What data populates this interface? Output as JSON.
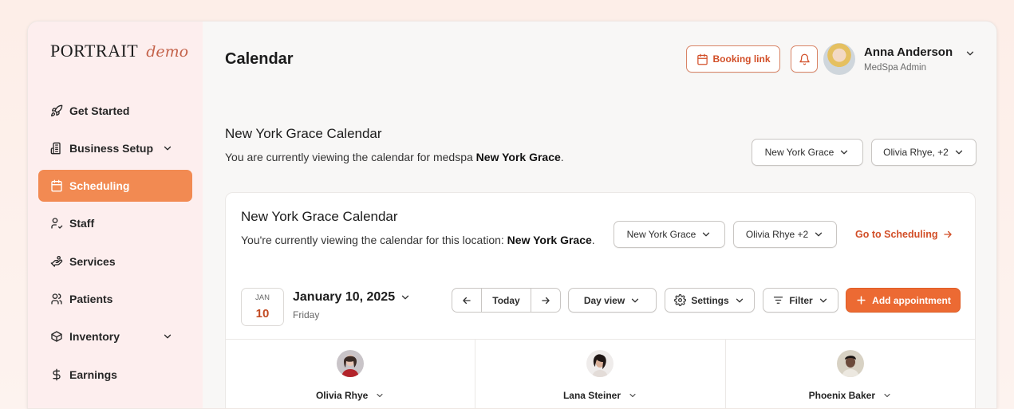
{
  "brand": {
    "name": "PORTRAIT",
    "tag": "demo"
  },
  "sidebar": {
    "items": [
      {
        "label": "Get Started",
        "icon": "rocket-icon"
      },
      {
        "label": "Business Setup",
        "icon": "building-icon",
        "expandable": true
      },
      {
        "label": "Scheduling",
        "icon": "calendar-icon",
        "active": true
      },
      {
        "label": "Staff",
        "icon": "staff-icon"
      },
      {
        "label": "Services",
        "icon": "hand-service-icon"
      },
      {
        "label": "Patients",
        "icon": "users-icon"
      },
      {
        "label": "Inventory",
        "icon": "box-icon",
        "expandable": true
      },
      {
        "label": "Earnings",
        "icon": "dollar-icon"
      }
    ]
  },
  "header": {
    "title": "Calendar",
    "booking_link_label": "Booking link",
    "user": {
      "name": "Anna Anderson",
      "role": "MedSpa Admin"
    }
  },
  "section": {
    "title": "New York Grace Calendar",
    "desc_prefix": "You are currently viewing the calendar for medspa ",
    "desc_bold": "New York Grace",
    "desc_suffix": ".",
    "location_select": "New York Grace",
    "staff_select": "Olivia Rhye, +2"
  },
  "card": {
    "title": "New York Grace Calendar",
    "desc_prefix": "You're currently viewing the calendar for this location: ",
    "desc_bold": "New York Grace",
    "desc_suffix": ".",
    "location_select": "New York Grace",
    "staff_select": "Olivia Rhye +2",
    "scheduling_link": "Go to Scheduling",
    "date": {
      "month": "JAN",
      "day": "10",
      "full": "January 10, 2025",
      "weekday": "Friday"
    },
    "toolbar": {
      "today": "Today",
      "view": "Day view",
      "settings": "Settings",
      "filter": "Filter",
      "add": "Add appointment"
    },
    "staff": [
      {
        "name": "Olivia Rhye"
      },
      {
        "name": "Lana Steiner"
      },
      {
        "name": "Phoenix Baker"
      }
    ]
  },
  "colors": {
    "accent": "#ec6a33",
    "active_nav": "#f28a52",
    "sidebar_bg": "#fdeeee",
    "link": "#d24f28"
  }
}
